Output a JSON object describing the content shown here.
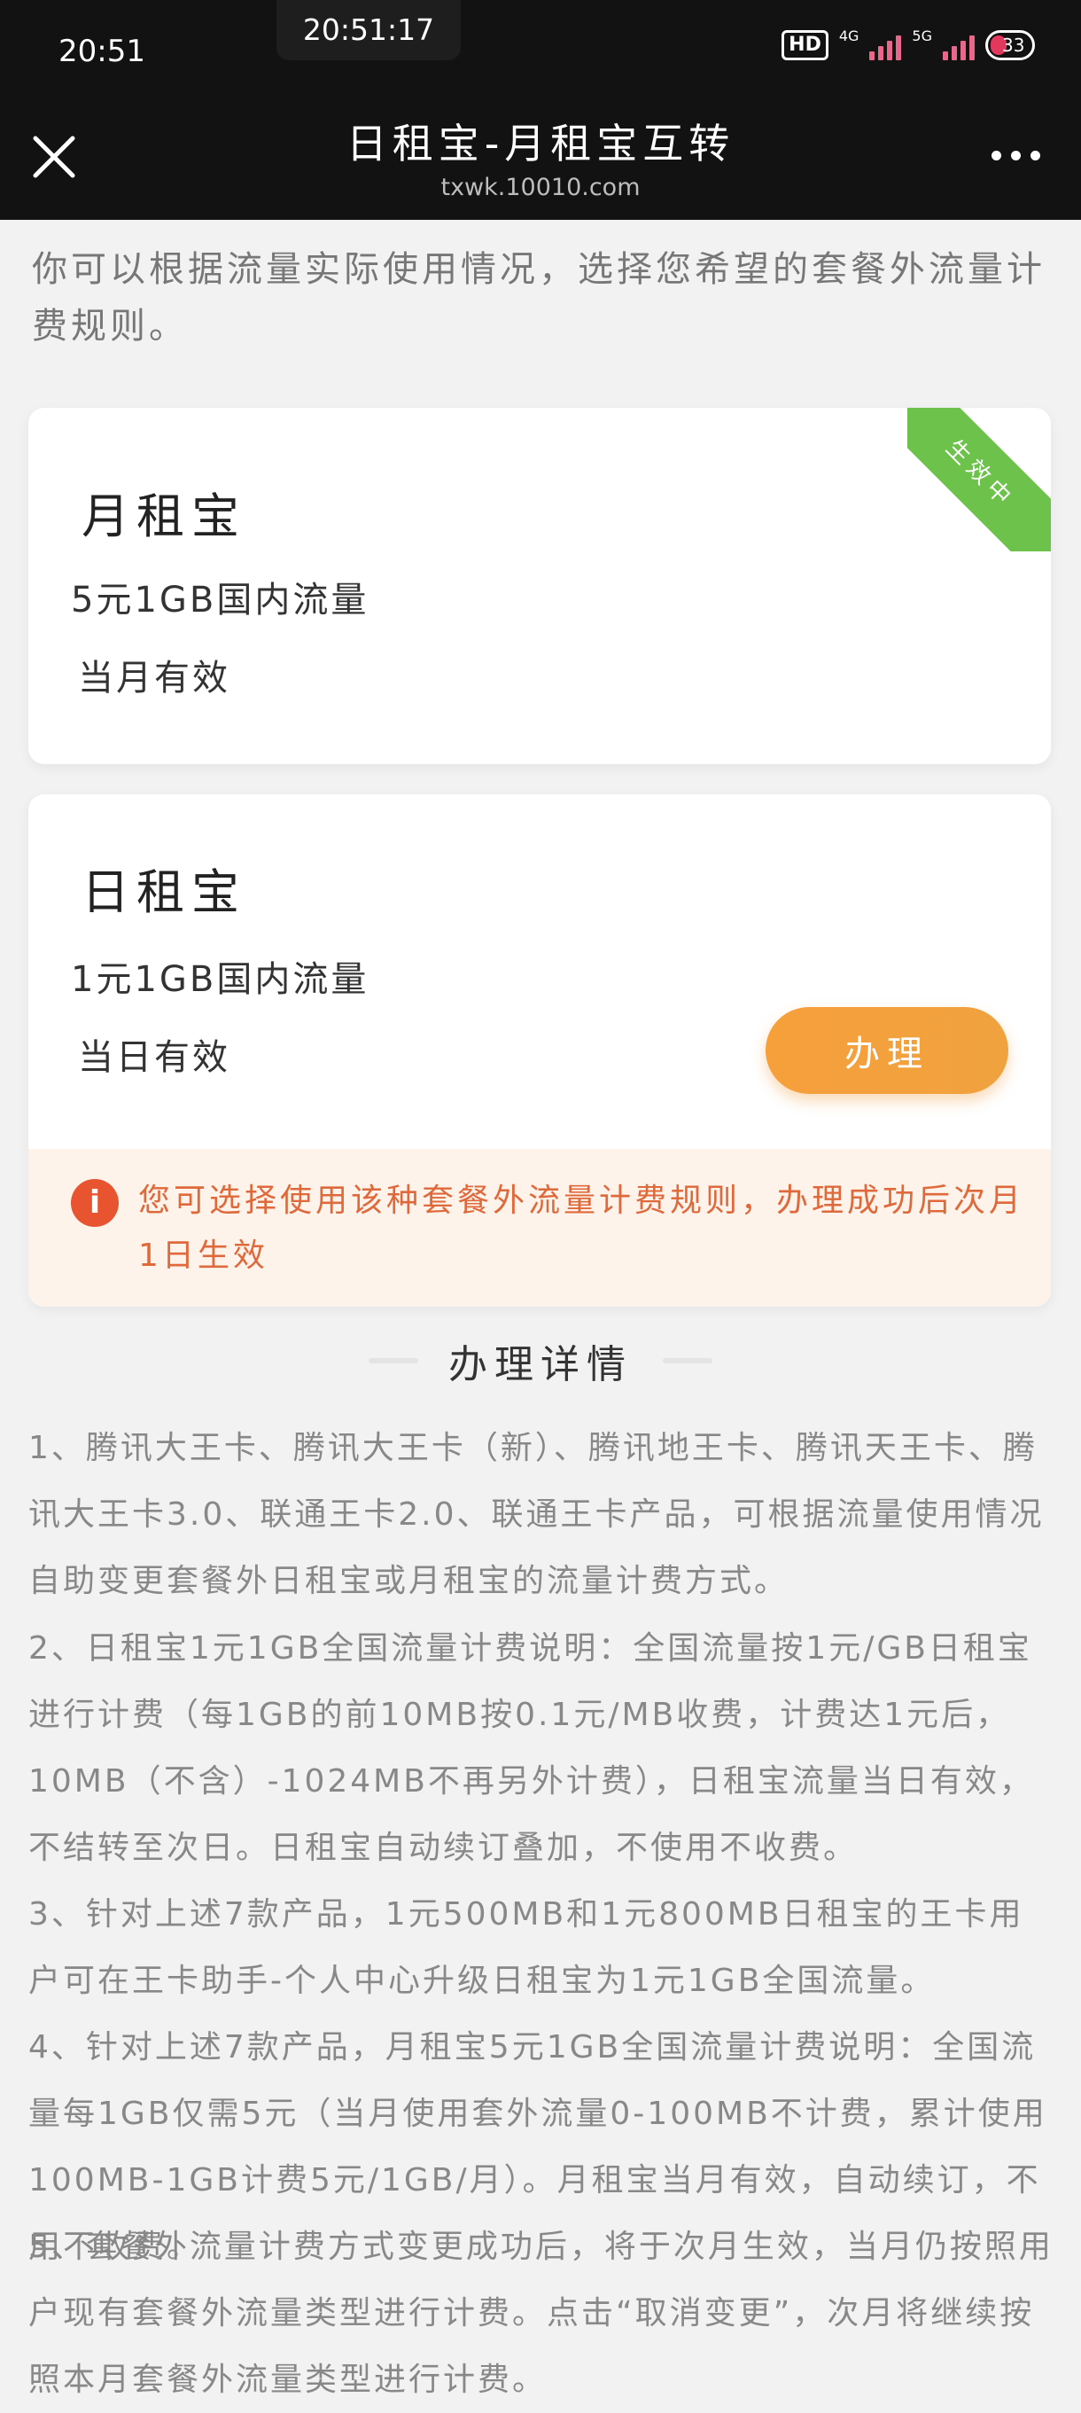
{
  "status_bar": {
    "time": "20:51",
    "clock": "20:51:17",
    "hd_label": "HD",
    "net1": "4G",
    "net2": "5G",
    "battery": "33"
  },
  "nav": {
    "title": "日租宝-月租宝互转",
    "url": "txwk.10010.com"
  },
  "intro": "你可以根据流量实际使用情况，选择您希望的套餐外流量计费规则。",
  "monthly_card": {
    "title": "月租宝",
    "price": "5元1GB国内流量",
    "validity": "当月有效",
    "ribbon": "生效中"
  },
  "daily_card": {
    "title": "日租宝",
    "price": "1元1GB国内流量",
    "validity": "当日有效",
    "button_label": "办理",
    "notice": "您可选择使用该种套餐外流量计费规则，办理成功后次月1日生效"
  },
  "details": {
    "heading": "办理详情",
    "items": [
      "1、腾讯大王卡、腾讯大王卡（新）、腾讯地王卡、腾讯天王卡、腾讯大王卡3.0、联通王卡2.0、联通王卡产品，可根据流量使用情况自助变更套餐外日租宝或月租宝的流量计费方式。",
      "2、日租宝1元1GB全国流量计费说明：全国流量按1元/GB日租宝进行计费（每1GB的前10MB按0.1元/MB收费，计费达1元后，10MB（不含）-1024MB不再另外计费），日租宝流量当日有效，不结转至次日。日租宝自动续订叠加，不使用不收费。",
      "3、针对上述7款产品，1元500MB和1元800MB日租宝的王卡用户可在王卡助手-个人中心升级日租宝为1元1GB全国流量。",
      "4、针对上述7款产品，月租宝5元1GB全国流量计费说明：全国流量每1GB仅需5元（当月使用套外流量0-100MB不计费，累计使用100MB-1GB计费5元/1GB/月）。月租宝当月有效，自动续订，不用不收费。",
      "5、套餐外流量计费方式变更成功后，将于次月生效，当月仍按照用户现有套餐外流量类型进行计费。点击“取消变更”，次月将继续按照本月套餐外流量类型进行计费。"
    ]
  }
}
